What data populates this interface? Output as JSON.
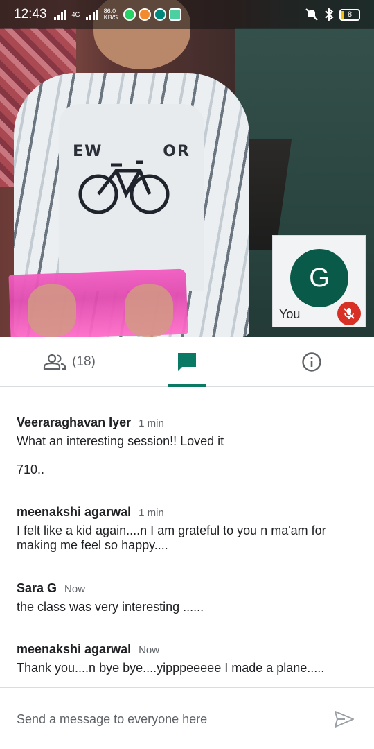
{
  "status_bar": {
    "time": "12:43",
    "network_type": "4G",
    "data_speed_value": "86.0",
    "data_speed_unit": "KB/S",
    "battery_level": "8",
    "icons": [
      "signal-icon",
      "whatsapp-icon",
      "notification-icon",
      "camera-icon",
      "silent-icon",
      "bluetooth-icon",
      "battery-icon"
    ]
  },
  "self_tile": {
    "avatar_initial": "G",
    "label": "You",
    "mic_state": "muted",
    "avatar_color": "#0a5a4a",
    "mic_color": "#d93025"
  },
  "tabs": {
    "people_count": "(18)",
    "active": "chat",
    "accent_color": "#0b7a64"
  },
  "messages": [
    {
      "author": "Veeraraghavan Iyer",
      "time": "1 min",
      "lines": [
        "What an interesting session!! Loved it",
        "710.."
      ]
    },
    {
      "author": "meenakshi agarwal",
      "time": "1 min",
      "lines": [
        "I felt like a kid again....n I am grateful to you n ma'am for making me feel so happy...."
      ]
    },
    {
      "author": "Sara G",
      "time": "Now",
      "lines": [
        "the class was very interesting ......"
      ]
    },
    {
      "author": "meenakshi agarwal",
      "time": "Now",
      "lines": [
        "Thank you....n bye bye....yipppeeeee I made a plane....."
      ]
    }
  ],
  "composer": {
    "placeholder": "Send a message to everyone here"
  }
}
